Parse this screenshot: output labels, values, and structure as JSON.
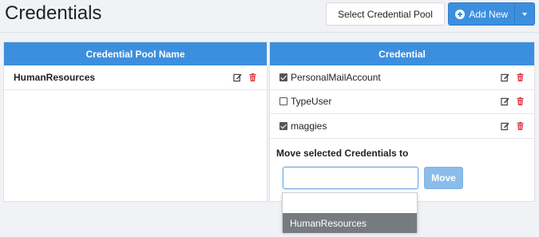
{
  "header": {
    "title": "Credentials",
    "pool_select_label": "Select Credential Pool",
    "add_new_label": "Add New"
  },
  "pools": {
    "column_header": "Credential Pool Name",
    "rows": [
      {
        "name": "HumanResources"
      }
    ]
  },
  "credentials": {
    "column_header": "Credential",
    "rows": [
      {
        "name": "PersonalMailAccount",
        "checked": true
      },
      {
        "name": "TypeUser",
        "checked": false
      },
      {
        "name": "maggies",
        "checked": true
      }
    ],
    "move_label": "Move selected Credentials to",
    "move_input_value": "",
    "move_button_label": "Move",
    "dropdown_options": [
      "",
      "HumanResources"
    ]
  },
  "colors": {
    "accent": "#3c8fde",
    "delete": "#e0323c",
    "selected_option": "#777b80"
  },
  "icons": {
    "add": "plus-circle-icon",
    "caret": "caret-down-icon",
    "edit": "edit-icon",
    "delete": "trash-icon"
  }
}
